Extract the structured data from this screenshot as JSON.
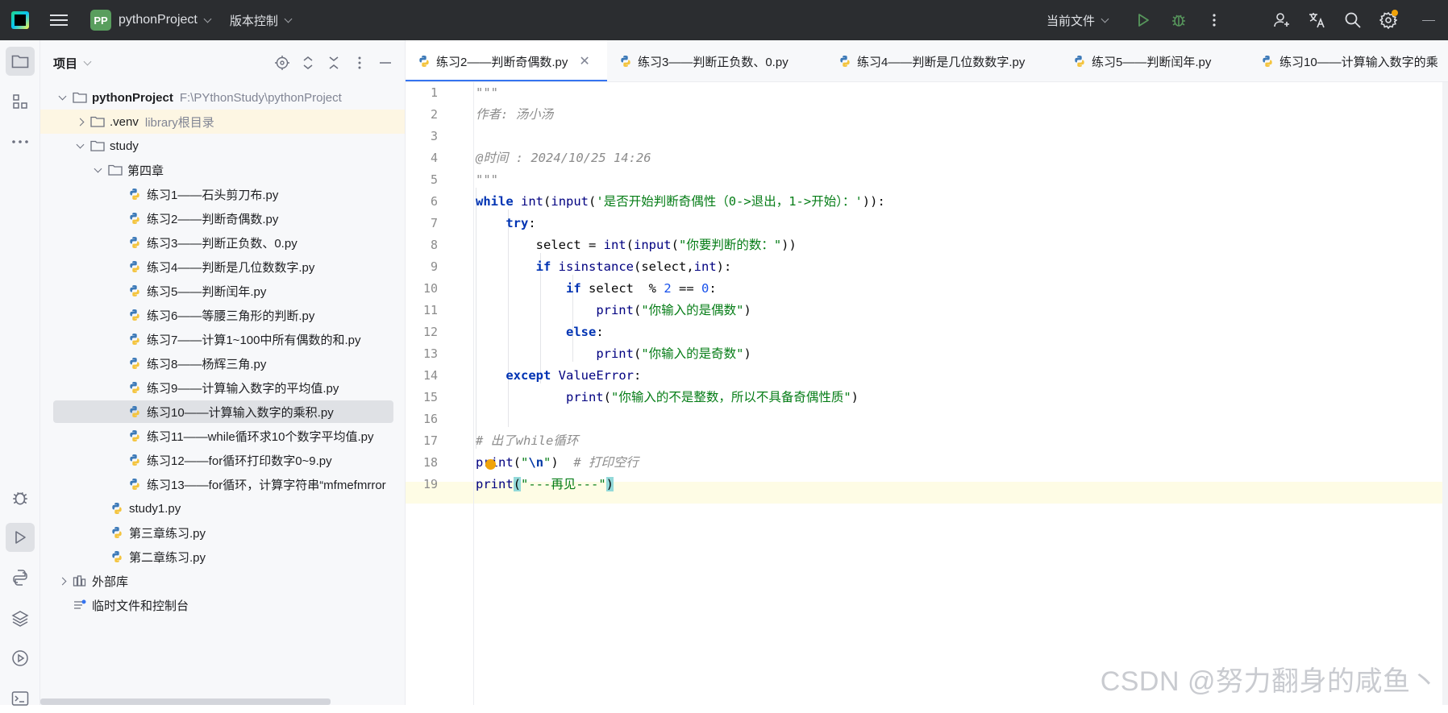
{
  "titlebar": {
    "project_badge": "PP",
    "project_name": "pythonProject",
    "vcs_label": "版本控制",
    "run_config": "当前文件",
    "icons": [
      "run-icon",
      "debug-icon",
      "more-icon",
      "add-user-icon",
      "translate-icon",
      "search-icon",
      "settings-icon"
    ]
  },
  "left_strip": {
    "icons": [
      "folder-icon",
      "structure-icon",
      "more-tools-icon",
      "debug-tool-icon",
      "run-tool-icon",
      "python-console-icon",
      "layers-icon",
      "services-icon",
      "terminal-icon"
    ]
  },
  "project_panel": {
    "title": "项目",
    "tree": [
      {
        "label": "pythonProject",
        "extra": "F:\\PYthonStudy\\pythonProject",
        "type": "folder",
        "bold": true
      },
      {
        "label": ".venv",
        "extra": "library根目录",
        "type": "folder"
      },
      {
        "label": "study",
        "type": "folder"
      },
      {
        "label": "第四章",
        "type": "folder"
      },
      {
        "label": "练习1——石头剪刀布.py",
        "type": "py"
      },
      {
        "label": "练习2——判断奇偶数.py",
        "type": "py"
      },
      {
        "label": "练习3——判断正负数、0.py",
        "type": "py"
      },
      {
        "label": "练习4——判断是几位数数字.py",
        "type": "py"
      },
      {
        "label": "练习5——判断闰年.py",
        "type": "py"
      },
      {
        "label": "练习6——等腰三角形的判断.py",
        "type": "py"
      },
      {
        "label": "练习7——计算1~100中所有偶数的和.py",
        "type": "py"
      },
      {
        "label": "练习8——杨辉三角.py",
        "type": "py"
      },
      {
        "label": "练习9——计算输入数字的平均值.py",
        "type": "py"
      },
      {
        "label": "练习10——计算输入数字的乘积.py",
        "type": "py",
        "selected": true
      },
      {
        "label": "练习11——while循环求10个数字平均值.py",
        "type": "py"
      },
      {
        "label": "练习12——for循环打印数字0~9.py",
        "type": "py"
      },
      {
        "label": "练习13——for循环，计算字符串“mfmefmrror",
        "type": "py"
      },
      {
        "label": "study1.py",
        "type": "py"
      },
      {
        "label": "第三章练习.py",
        "type": "py"
      },
      {
        "label": "第二章练习.py",
        "type": "py"
      },
      {
        "label": "外部库",
        "type": "lib"
      },
      {
        "label": "临时文件和控制台",
        "type": "scratch"
      }
    ]
  },
  "tabs": [
    {
      "label": "练习2——判断奇偶数.py",
      "active": true
    },
    {
      "label": "练习3——判断正负数、0.py"
    },
    {
      "label": "练习4——判断是几位数数字.py"
    },
    {
      "label": "练习5——判断闰年.py"
    },
    {
      "label": "练习10——计算输入数字的乘"
    }
  ],
  "editor": {
    "line_numbers": [
      "1",
      "2",
      "3",
      "4",
      "5",
      "6",
      "7",
      "8",
      "9",
      "10",
      "11",
      "12",
      "13",
      "14",
      "15",
      "16",
      "17",
      "18",
      "19"
    ],
    "code": [
      "\"\"\"",
      "作者: 汤小汤",
      "",
      "@时间 : 2024/10/25 14:26",
      "\"\"\"",
      "while int(input('是否开始判断奇偶性（0->退出，1->开始）：')):",
      "    try:",
      "        select = int(input(\"你要判断的数：\"))",
      "        if isinstance(select,int):",
      "            if select  % 2 == 0:",
      "                print(\"你输入的是偶数\")",
      "            else:",
      "                print(\"你输入的是奇数\")",
      "    except ValueError:",
      "            print(\"你输入的不是整数，所以不具备奇偶性质\")",
      "",
      "# 出了while循环",
      "print(\"\\n\")  # 打印空行",
      "print(\"---再见---\")"
    ]
  },
  "watermark": "CSDN @努力翻身的咸鱼丶"
}
